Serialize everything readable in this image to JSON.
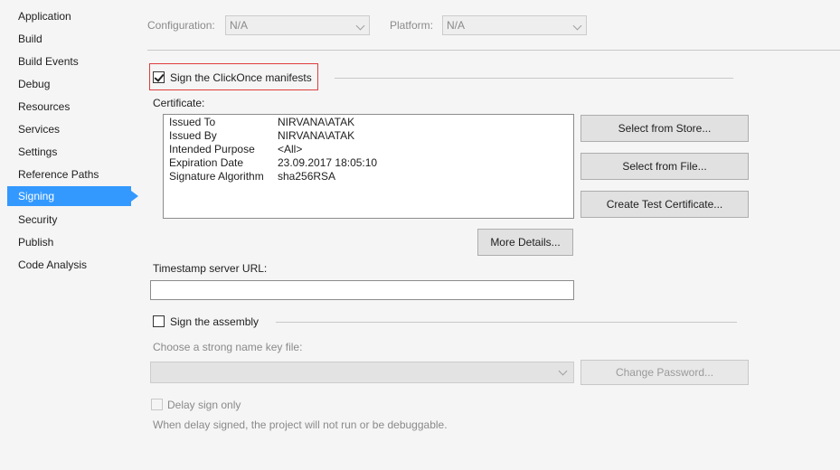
{
  "sidebar": {
    "items": [
      {
        "label": "Application"
      },
      {
        "label": "Build"
      },
      {
        "label": "Build Events"
      },
      {
        "label": "Debug"
      },
      {
        "label": "Resources"
      },
      {
        "label": "Services"
      },
      {
        "label": "Settings"
      },
      {
        "label": "Reference Paths"
      },
      {
        "label": "Signing",
        "active": true
      },
      {
        "label": "Security"
      },
      {
        "label": "Publish"
      },
      {
        "label": "Code Analysis"
      }
    ]
  },
  "config": {
    "configuration_label": "Configuration:",
    "configuration_value": "N/A",
    "platform_label": "Platform:",
    "platform_value": "N/A"
  },
  "signing": {
    "sign_manifests_label": "Sign the ClickOnce manifests",
    "sign_manifests_checked": true,
    "certificate_label": "Certificate:",
    "certificate": [
      {
        "key": "Issued To",
        "value": "NIRVANA\\ATAK"
      },
      {
        "key": "Issued By",
        "value": "NIRVANA\\ATAK"
      },
      {
        "key": "Intended Purpose",
        "value": "<All>"
      },
      {
        "key": "Expiration Date",
        "value": "23.09.2017 18:05:10"
      },
      {
        "key": "Signature Algorithm",
        "value": "sha256RSA"
      }
    ],
    "buttons": {
      "select_from_store": "Select from Store...",
      "select_from_file": "Select from File...",
      "create_test_certificate": "Create Test Certificate...",
      "more_details": "More Details..."
    },
    "timestamp_label": "Timestamp server URL:",
    "timestamp_value": "",
    "sign_assembly_label": "Sign the assembly",
    "sign_assembly_checked": false,
    "strong_name_label": "Choose a strong name key file:",
    "strong_name_value": "",
    "change_password": "Change Password...",
    "delay_sign_label": "Delay sign only",
    "delay_sign_checked": false,
    "delay_sign_note": "When delay signed, the project will not run or be debuggable."
  }
}
